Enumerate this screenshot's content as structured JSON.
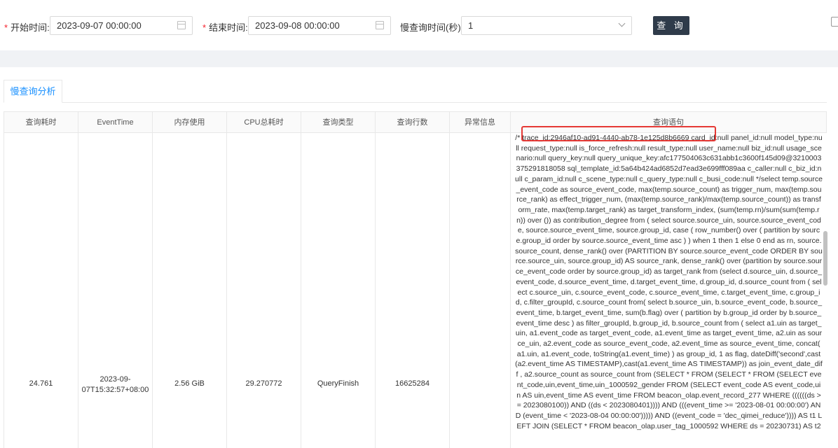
{
  "filters": {
    "start": {
      "required_mark": "*",
      "label": "开始时间:",
      "value": "2023-09-07 00:00:00"
    },
    "end": {
      "required_mark": "*",
      "label": "结束时间:",
      "value": "2023-09-08 00:00:00"
    },
    "slow": {
      "label": "慢查询时间(秒)",
      "value": "1"
    },
    "query_button": "查 询"
  },
  "tabs": [
    {
      "label": "慢查询分析",
      "active": true
    }
  ],
  "table": {
    "columns": [
      "查询耗时",
      "EventTime",
      "内存使用",
      "CPU总耗时",
      "查询类型",
      "查询行数",
      "异常信息",
      "查询语句"
    ],
    "rows": [
      {
        "duration": "24.761",
        "event_time": "2023-09-07T15:32:57+08:00",
        "memory": "2.56 GiB",
        "cpu": "29.270772",
        "query_type": "QueryFinish",
        "rows": "16625284",
        "error": "",
        "sql_highlight": "/* trace_id:2946af10-ad91-4440-ab78-1e125d8b6669",
        "sql_rest": " card_id:null panel_id:null model_type:null request_type:null is_force_refresh:null result_type:null user_name:null biz_id:null usage_scenario:null query_key:null query_unique_key:afc177504063c631abb1c3600f145d09@3210003375291818058 sql_template_id:5a64b424ad6852d7ead3e699fff089aa c_caller:null c_biz_id:null c_param_id:null c_scene_type:null c_query_type:null c_busi_code:null */select temp.source_event_code as source_event_code, max(temp.source_count) as trigger_num, max(temp.source_rank) as effect_trigger_num, (max(temp.source_rank)/max(temp.source_count)) as transform_rate, max(temp.target_rank) as target_transform_index, (sum(temp.rn)/sum(sum(temp.rn)) over ()) as contribution_degree from ( select source.source_uin, source.source_event_code, source.source_event_time, source.group_id, case ( row_number() over ( partition by source.group_id order by source.source_event_time asc ) ) when 1 then 1 else 0 end as rn, source.source_count, dense_rank() over (PARTITION BY source.source_event_code ORDER BY source.source_uin, source.group_id) AS source_rank, dense_rank() over (partition by source.source_event_code order by source.group_id) as target_rank from (select d.source_uin, d.source_event_code, d.source_event_time, d.target_event_time, d.group_id, d.source_count from ( select c.source_uin, c.source_event_code, c.source_event_time, c.target_event_time, c.group_id, c.filter_groupId, c.source_count from( select b.source_uin, b.source_event_code, b.source_event_time, b.target_event_time, sum(b.flag) over ( partition by b.group_id order by b.source_event_time desc ) as filter_groupId, b.group_id, b.source_count from ( select a1.uin as target_uin, a1.event_code as target_event_code, a1.event_time as target_event_time, a2.uin as source_uin, a2.event_code as source_event_code, a2.event_time as source_event_time, concat( a1.uin, a1.event_code, toString(a1.event_time) ) as group_id, 1 as flag, dateDiff('second',cast(a2.event_time AS TIMESTAMP),cast(a1.event_time AS TIMESTAMP)) as join_event_date_diff , a2.source_count as source_count from (SELECT * FROM (SELECT * FROM (SELECT event_code,uin,event_time,uin_1000592_gender FROM (SELECT event_code AS event_code,uin AS uin,event_time AS event_time FROM beacon_olap.event_record_277 WHERE ((((((ds >= 2023080100)) AND ((ds < 2023080401)))) AND (((event_time >= '2023-08-01 00:00:00') AND (event_time < '2023-08-04 00:00:00'))))) AND ((event_code = 'dec_qimei_reduce')))) AS t1 LEFT JOIN (SELECT * FROM beacon_olap.user_tag_1000592 WHERE ds = 20230731) AS t2"
      }
    ]
  }
}
